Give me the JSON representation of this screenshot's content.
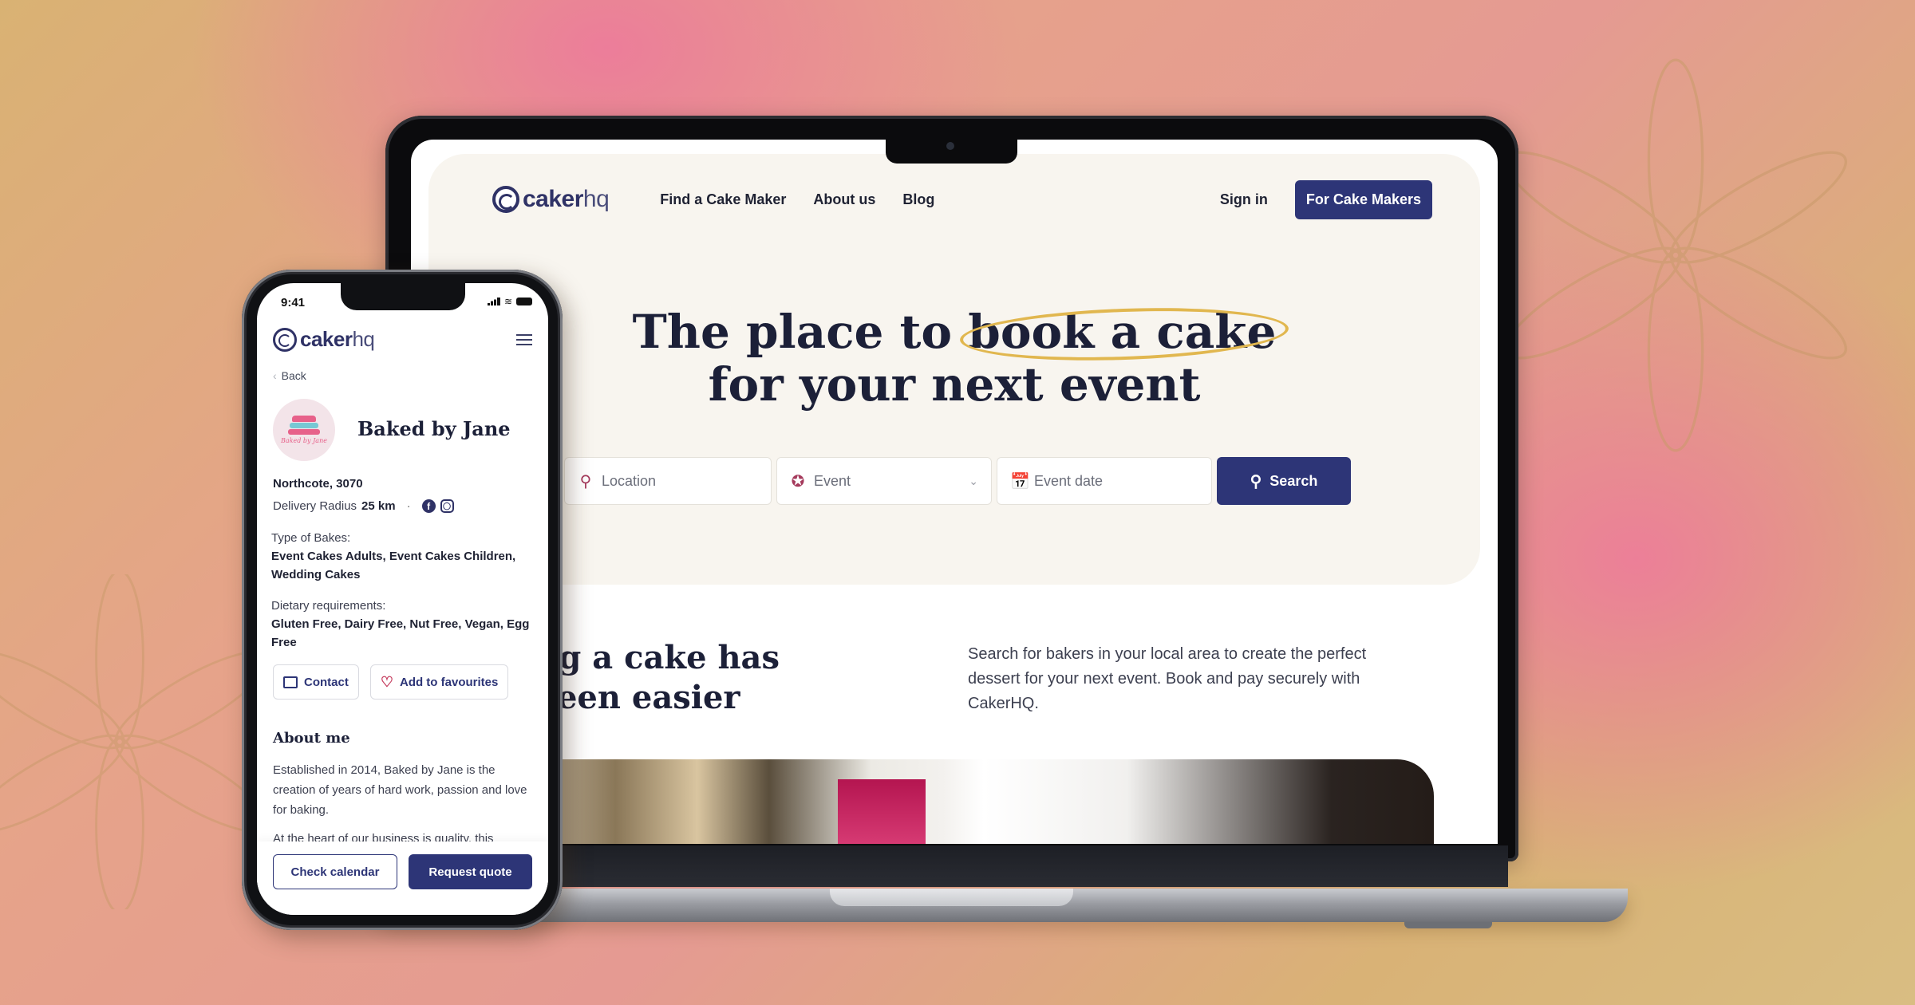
{
  "brand": {
    "logo_bold": "caker",
    "logo_light": "hq",
    "accent_color": "#2d3577",
    "highlight_color": "#e1b74f"
  },
  "desktop": {
    "nav": {
      "links": [
        "Find a Cake Maker",
        "About us",
        "Blog"
      ],
      "sign_in": "Sign in",
      "cta": "For Cake Makers"
    },
    "hero": {
      "title_pre": "The place to ",
      "title_highlight": "book a cake",
      "title_line2": "for your next event"
    },
    "search": {
      "location_placeholder": "Location",
      "event_placeholder": "Event",
      "date_placeholder": "Event date",
      "button": "Search"
    },
    "intro": {
      "heading_line1": "ring a cake has",
      "heading_line2": "r been easier",
      "description": "Search for bakers in your local area to create the perfect dessert for your next event.  Book and pay securely with CakerHQ."
    }
  },
  "mobile": {
    "status": {
      "time": "9:41"
    },
    "back": "Back",
    "baker": {
      "name": "Baked by Jane",
      "avatar_text": "Baked by Jane",
      "location": "Northcote, 3070",
      "radius_label": "Delivery Radius",
      "radius_value": "25 km",
      "bakes_label": "Type of Bakes:",
      "bakes_value": "Event Cakes Adults, Event Cakes Children, Wedding Cakes",
      "diet_label": "Dietary requirements:",
      "diet_value": "Gluten Free, Dairy Free, Nut Free, Vegan, Egg Free"
    },
    "actions": {
      "contact": "Contact",
      "favourite": "Add to favourites"
    },
    "about": {
      "heading": "About me",
      "para1": "Established in 2014, Baked by Jane is the creation of years of hard work, passion and love for baking.",
      "para2": "At the heart of our business is quality, this"
    },
    "footer": {
      "calendar": "Check calendar",
      "quote": "Request quote"
    }
  }
}
